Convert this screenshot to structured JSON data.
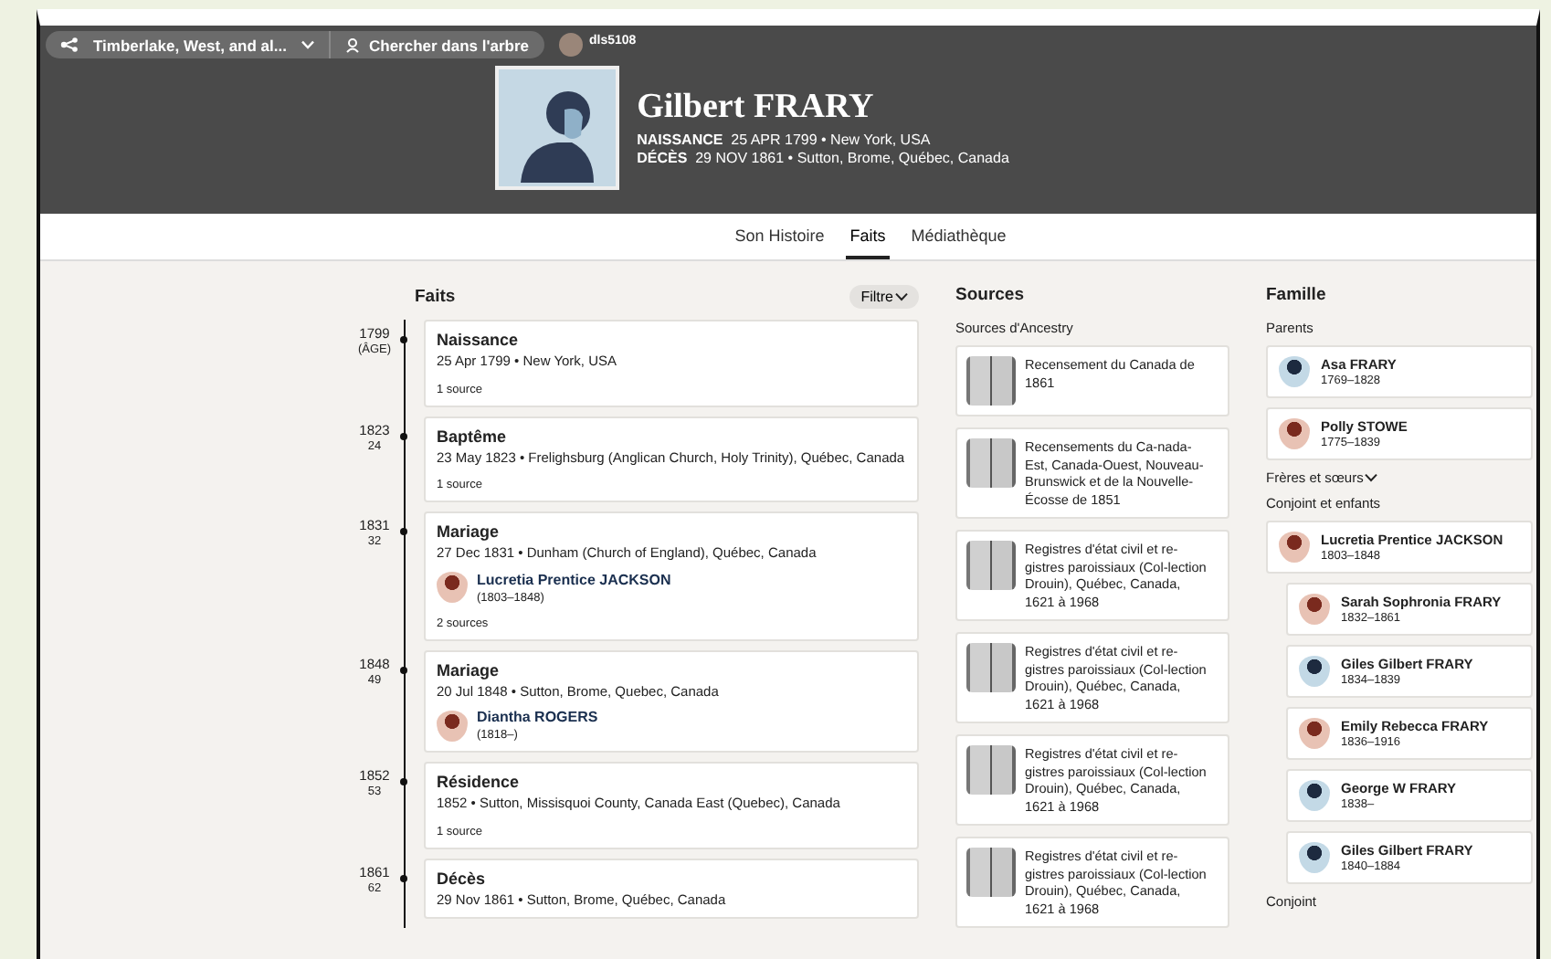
{
  "top_bar": {
    "tree_name": "Timberlake, West, and al...",
    "search_label": "Chercher dans l'arbre",
    "user": "dls5108"
  },
  "person": {
    "name": "Gilbert FRARY",
    "birth": {
      "label": "NAISSANCE",
      "value": "25 APR 1799 • New York, USA"
    },
    "death": {
      "label": "DÉCÈS",
      "value": "29 NOV 1861 • Sutton, Brome, Québec, Canada"
    }
  },
  "tabs": [
    {
      "label": "Son Histoire",
      "selected": false
    },
    {
      "label": "Faits",
      "selected": true
    },
    {
      "label": "Médiathèque",
      "selected": false
    }
  ],
  "facts": {
    "title": "Faits",
    "filter": "Filtre",
    "items": [
      {
        "year": "1799",
        "age": "(ÂGE)",
        "title": "Naissance",
        "detail": "25 Apr 1799 • New York, USA",
        "sources": "1 source"
      },
      {
        "year": "1823",
        "age": "24",
        "title": "Baptême",
        "detail": "23 May 1823 • Frelighsburg (Anglican Church, Holy Trinity), Québec, Canada",
        "sources": "1 source"
      },
      {
        "year": "1831",
        "age": "32",
        "title": "Mariage",
        "detail": "27 Dec 1831 • Dunham (Church of England), Québec, Canada",
        "spouse": {
          "name": "Lucretia Prentice JACKSON",
          "dates": "(1803–1848)",
          "kind": "female"
        },
        "sources": "2 sources"
      },
      {
        "year": "1848",
        "age": "49",
        "title": "Mariage",
        "detail": "20 Jul 1848 • Sutton, Brome, Quebec, Canada",
        "spouse": {
          "name": "Diantha ROGERS",
          "dates": "(1818–)",
          "kind": "female"
        }
      },
      {
        "year": "1852",
        "age": "53",
        "title": "Résidence",
        "detail": "1852 • Sutton, Missisquoi County, Canada East (Quebec), Canada",
        "sources": "1 source"
      },
      {
        "year": "1861",
        "age": "62",
        "title": "Décès",
        "detail": "29 Nov 1861 • Sutton, Brome, Québec, Canada"
      }
    ]
  },
  "sources": {
    "title": "Sources",
    "subtitle": "Sources d'Ancestry",
    "items": [
      {
        "title": "Recensement du Canada de 1861"
      },
      {
        "title": "Recensements du Ca-nada-Est, Canada-Ouest, Nouveau-Brunswick et de la Nouvelle-Écosse de 1851"
      },
      {
        "title": "Registres d'état civil et re-gistres paroissiaux (Col-lection Drouin), Québec, Canada, 1621 à 1968"
      },
      {
        "title": "Registres d'état civil et re-gistres paroissiaux (Col-lection Drouin), Québec, Canada, 1621 à 1968"
      },
      {
        "title": "Registres d'état civil et re-gistres paroissiaux (Col-lection Drouin), Québec, Canada, 1621 à 1968"
      },
      {
        "title": "Registres d'état civil et re-gistres paroissiaux (Col-lection Drouin), Québec, Canada, 1621 à 1968"
      }
    ]
  },
  "family": {
    "title": "Famille",
    "parents_label": "Parents",
    "parents": [
      {
        "name": "Asa FRARY",
        "dates": "1769–1828",
        "kind": "male"
      },
      {
        "name": "Polly STOWE",
        "dates": "1775–1839",
        "kind": "female"
      }
    ],
    "siblings": {
      "label": "Frères et sœurs",
      "expanded": false
    },
    "spouses_label": "Conjoint et enfants",
    "spouses": [
      {
        "name": "Lucretia Prentice JACKSON",
        "dates": "1803–1848",
        "kind": "female",
        "children": [
          {
            "name": "Sarah Sophronia FRARY",
            "dates": "1832–1861",
            "kind": "female"
          },
          {
            "name": "Giles Gilbert FRARY",
            "dates": "1834–1839",
            "kind": "male"
          },
          {
            "name": "Emily Rebecca FRARY",
            "dates": "1836–1916",
            "kind": "female"
          },
          {
            "name": "George W FRARY",
            "dates": "1838–",
            "kind": "male"
          },
          {
            "name": "Giles Gilbert FRARY",
            "dates": "1840–1884",
            "kind": "male"
          }
        ]
      }
    ],
    "spouse_label": "Conjoint"
  }
}
